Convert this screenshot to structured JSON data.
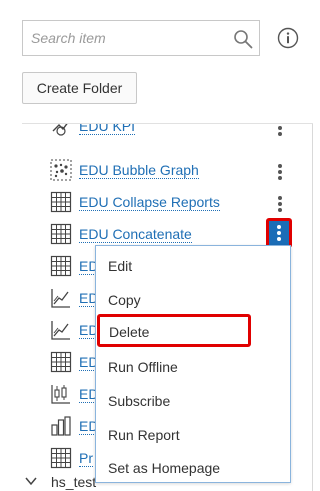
{
  "search": {
    "placeholder": "Search item",
    "value": ""
  },
  "toolbar": {
    "create_folder_label": "Create Folder"
  },
  "tree": {
    "items": [
      {
        "label": "EDU KPI",
        "icon": "kpi-icon"
      },
      {
        "label": "EDU Bubble Graph",
        "icon": "bubble-chart-icon"
      },
      {
        "label": "EDU Collapse Reports",
        "icon": "table-grid-icon"
      },
      {
        "label": "EDU Concatenate",
        "icon": "table-grid-icon"
      },
      {
        "label": "ED",
        "icon": "table-grid-icon"
      },
      {
        "label": "ED",
        "icon": "line-chart-icon"
      },
      {
        "label": "ED",
        "icon": "line-chart-icon"
      },
      {
        "label": "ED",
        "icon": "table-grid-icon"
      },
      {
        "label": "ED",
        "icon": "boxplot-icon"
      },
      {
        "label": "ED",
        "icon": "bar-chart-icon"
      },
      {
        "label": "Pr",
        "icon": "table-grid-icon"
      }
    ],
    "folder": {
      "label": "hs_test"
    }
  },
  "context_menu": {
    "items": [
      "Edit",
      "Copy",
      "Delete",
      "Run Offline",
      "Subscribe",
      "Run Report",
      "Set as Homepage"
    ],
    "highlighted": "Delete"
  },
  "colors": {
    "link": "#1f6fb5",
    "accent": "#1b6db7",
    "highlight": "#e00000"
  }
}
